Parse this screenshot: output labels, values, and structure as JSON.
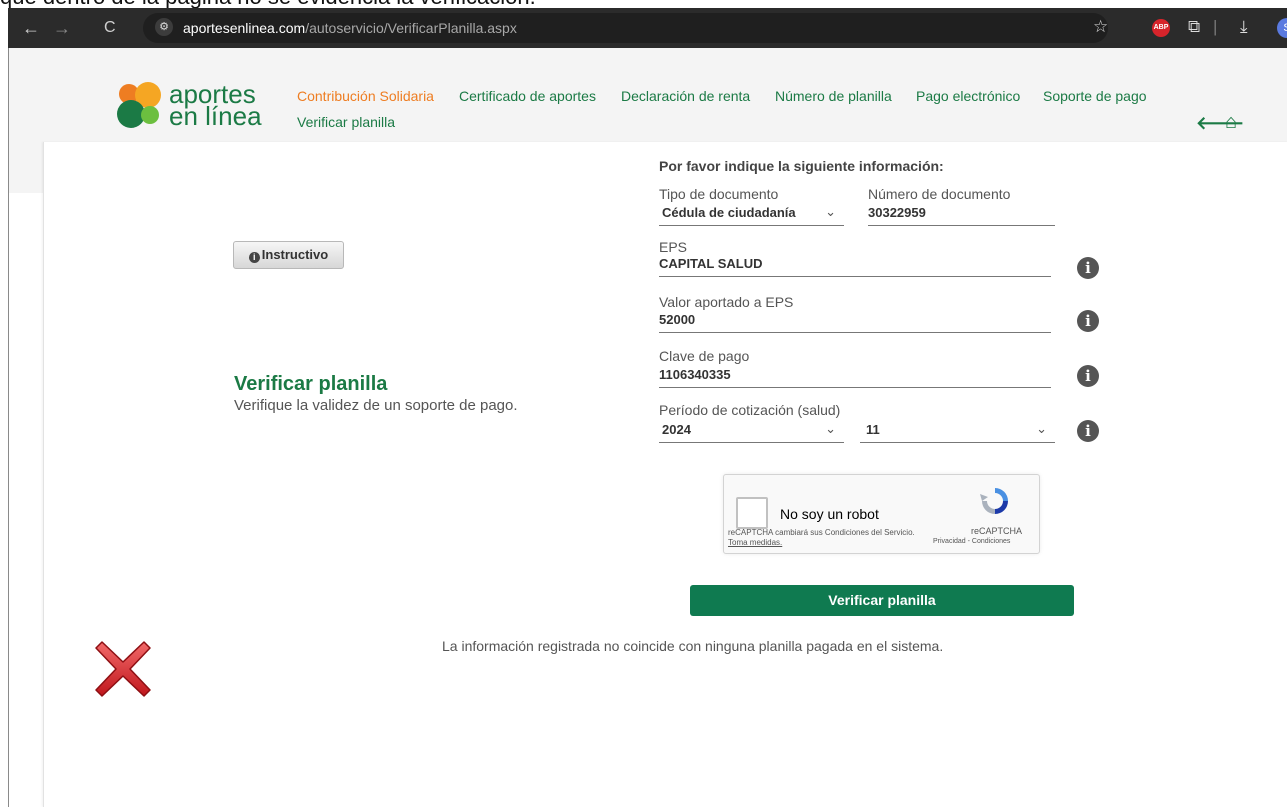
{
  "caption": {
    "text": "que dentro de la página no se evidencia la verificación."
  },
  "browser": {
    "url_domain": "aportesenlinea.com",
    "url_path": "/autoservicio/VerificarPlanilla.aspx",
    "back_icon": "arrow-left-icon",
    "forward_icon": "arrow-right-icon",
    "reload_icon": "reload-icon",
    "site_info_icon": "tune-icon",
    "bookmark_icon": "star-icon",
    "adblock_label": "ABP",
    "extensions_icon": "puzzle-icon",
    "download_icon": "download-icon",
    "profile_initial": "S"
  },
  "header": {
    "logo_line1": "aportes",
    "logo_line2": "en línea",
    "menu": [
      "Contribución Solidaria",
      "Certificado de aportes",
      "Declaración de renta",
      "Número de planilla",
      "Pago electrónico",
      "Soporte de pago",
      "Verificar planilla"
    ],
    "back_icon": "arrow-left-icon",
    "home_icon": "home-icon",
    "back_glyph": "🡐",
    "home_glyph": "⌂"
  },
  "left": {
    "instructivo_label": "Instructivo",
    "instructivo_icon": "info-icon",
    "title": "Verificar planilla",
    "subtitle": "Verifique la validez de un soporte de pago."
  },
  "form": {
    "prompt": "Por favor indique la siguiente información:",
    "tipo_documento": {
      "label": "Tipo de documento",
      "value": "Cédula de ciudadanía"
    },
    "numero_documento": {
      "label": "Número de documento",
      "value": "30322959"
    },
    "eps": {
      "label": "EPS",
      "value": "CAPITAL SALUD"
    },
    "valor_eps": {
      "label": "Valor aportado a EPS",
      "value": "52000"
    },
    "clave_pago": {
      "label": "Clave de pago",
      "value": "1106340335"
    },
    "periodo": {
      "label": "Período de cotización (salud)",
      "year": "2024",
      "month": "11"
    },
    "info_icon": "info-icon",
    "chevron_icon": "chevron-down-icon",
    "info_glyph": "i",
    "chevron_glyph": "⌄"
  },
  "captcha": {
    "label": "No soy un robot",
    "notice": "reCAPTCHA cambiará sus Condiciones del Servicio.",
    "notice_link": "Toma medidas.",
    "brand": "reCAPTCHA",
    "links": "Privacidad - Condiciones"
  },
  "submit": {
    "label": "Verificar planilla"
  },
  "result": {
    "message": "La información registrada no coincide con ninguna planilla pagada en el sistema.",
    "icon": "error-x-icon"
  },
  "colors": {
    "brand_green": "#1b7a45",
    "accent_orange": "#ee7d22",
    "button_green": "#0f7a50",
    "error_red": "#d9262c"
  }
}
